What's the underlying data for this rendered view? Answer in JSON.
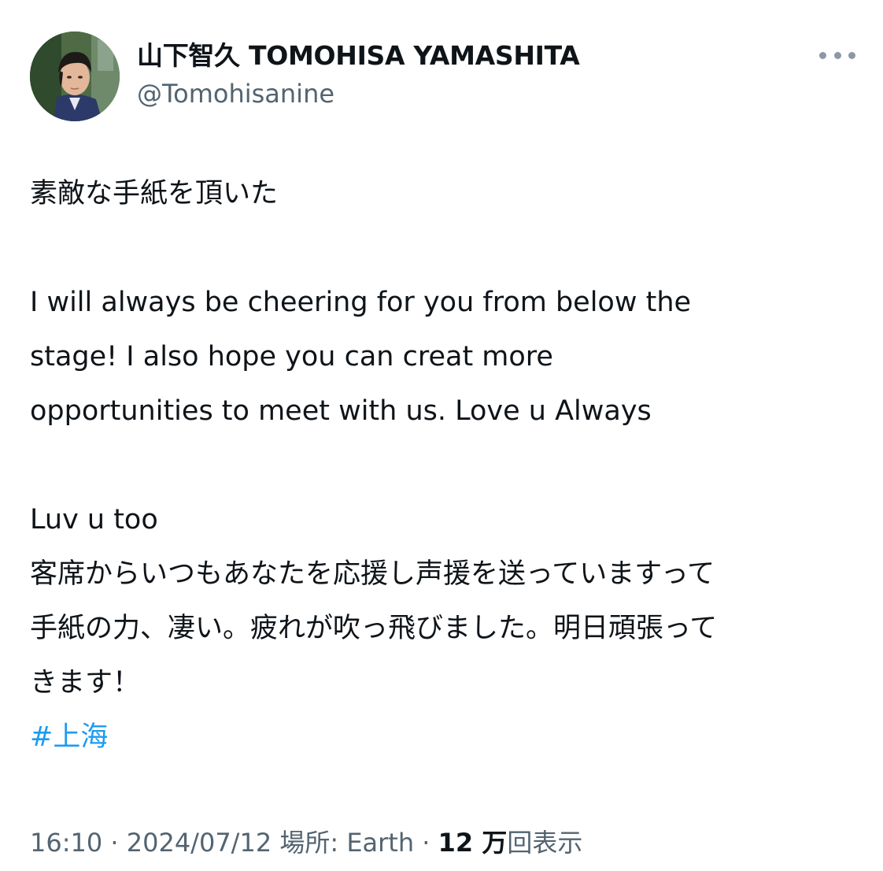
{
  "author": {
    "display_name": "山下智久 TOMOHISA YAMASHITA",
    "handle": "@Tomohisanine",
    "avatar": "profile-photo"
  },
  "more_menu": {
    "icon": "more-horizontal-icon"
  },
  "tweet": {
    "lines": {
      "l1": "素敵な手紙を頂いた",
      "l2": "I will always be cheering for you from below the",
      "l3": "stage! I also hope you can creat more",
      "l4": "opportunities to meet with us. Love u Always",
      "l5": "Luv u too",
      "l6": "客席からいつもあなたを応援し声援を送っていますって",
      "l7": "手紙の力、凄い。疲れが吹っ飛びました。明日頑張って",
      "l8": "きます！"
    },
    "hashtag": "#上海"
  },
  "meta": {
    "time": "16:10",
    "sep1": " · ",
    "date": "2024/07/12",
    "location_label": "場所: ",
    "location": "Earth",
    "sep2": " · ",
    "views_count": "12 万",
    "views_label": "回表示"
  },
  "colors": {
    "text": "#0f1419",
    "secondary": "#536471",
    "link": "#1d9bf0"
  }
}
